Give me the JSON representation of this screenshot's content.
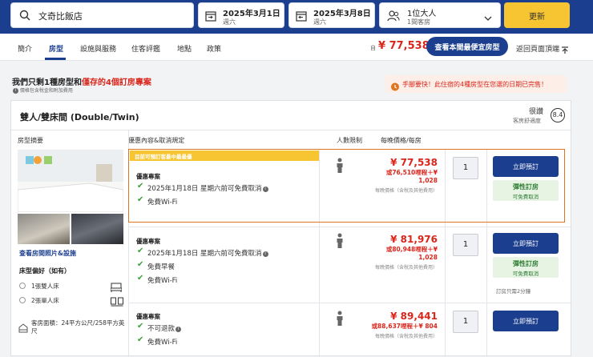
{
  "search": {
    "hotel": "文奇比飯店"
  },
  "dates": {
    "checkin": {
      "date": "2025年3月1日",
      "weekday": "週六"
    },
    "checkout": {
      "date": "2025年3月8日",
      "weekday": "週六"
    }
  },
  "guests": {
    "people": "1位大人",
    "rooms": "1間客房"
  },
  "update_label": "更新",
  "tabs": [
    "簡介",
    "房型",
    "設施與服務",
    "住客評鑑",
    "地點",
    "政策"
  ],
  "nav": {
    "from_label": "自",
    "lowest_price": "¥ 77,538",
    "cheapest_button": "查看本間最便宜房型",
    "back_to_top": "返回頁面頂端"
  },
  "notice": {
    "only_prefix": "我們只剩1種房型和",
    "only_red": "僅存的4個訂房專案",
    "subnote": "價格包含稅金和附加費用",
    "urgent": "手腳要快！此住宿的4種房型在您選的日期已完售！"
  },
  "room": {
    "title": "雙人/雙床間 (Double/Twin)",
    "rating_word": "很讚",
    "rating_sub": "客房舒適度",
    "rating_score": "8.4",
    "headers": [
      "房型摘要",
      "優惠內容&取消規定",
      "人數限制",
      "每晚價格/每房"
    ],
    "photos_link": "查看房間照片&設施",
    "bed_pref": "床型偏好（如有）",
    "beds": [
      "1張雙人床",
      "2張單人床"
    ],
    "size": "客房面積：24平方公尺/258平方英尺",
    "offers": [
      {
        "banner": "目前可預訂客最中最最優",
        "title": "優惠專案",
        "features": [
          "2025年1月18日 星期六前可免費取消",
          "免費Wi-Fi"
        ],
        "price": "¥ 77,538",
        "points": "或76,510哩程＋¥",
        "points2": "1,028",
        "note": "每晚價格（含稅及其他費用）",
        "qty": "1",
        "book": "立即預訂",
        "flex_a": "彈性訂房",
        "flex_b": "可免費取消",
        "min_note": ""
      },
      {
        "banner": "",
        "title": "優惠專案",
        "features": [
          "2025年1月18日 星期六前可免費取消",
          "免費早餐",
          "免費Wi-Fi"
        ],
        "price": "¥ 81,976",
        "points": "或80,948哩程＋¥",
        "points2": "1,028",
        "note": "每晚價格（含稅及其他費用）",
        "qty": "1",
        "book": "立即預訂",
        "flex_a": "彈性訂房",
        "flex_b": "可免費取消",
        "min_note": "訂房只需2分鐘"
      },
      {
        "banner": "",
        "title": "優惠專案",
        "features": [
          "不可退款",
          "免費Wi-Fi"
        ],
        "price": "¥ 89,441",
        "points": "或88,637哩程＋¥ 804",
        "points2": "",
        "note": "每晚價格（含稅及其他費用）",
        "qty": "1",
        "book": "立即預訂",
        "flex_a": "",
        "flex_b": "",
        "min_note": ""
      }
    ]
  }
}
